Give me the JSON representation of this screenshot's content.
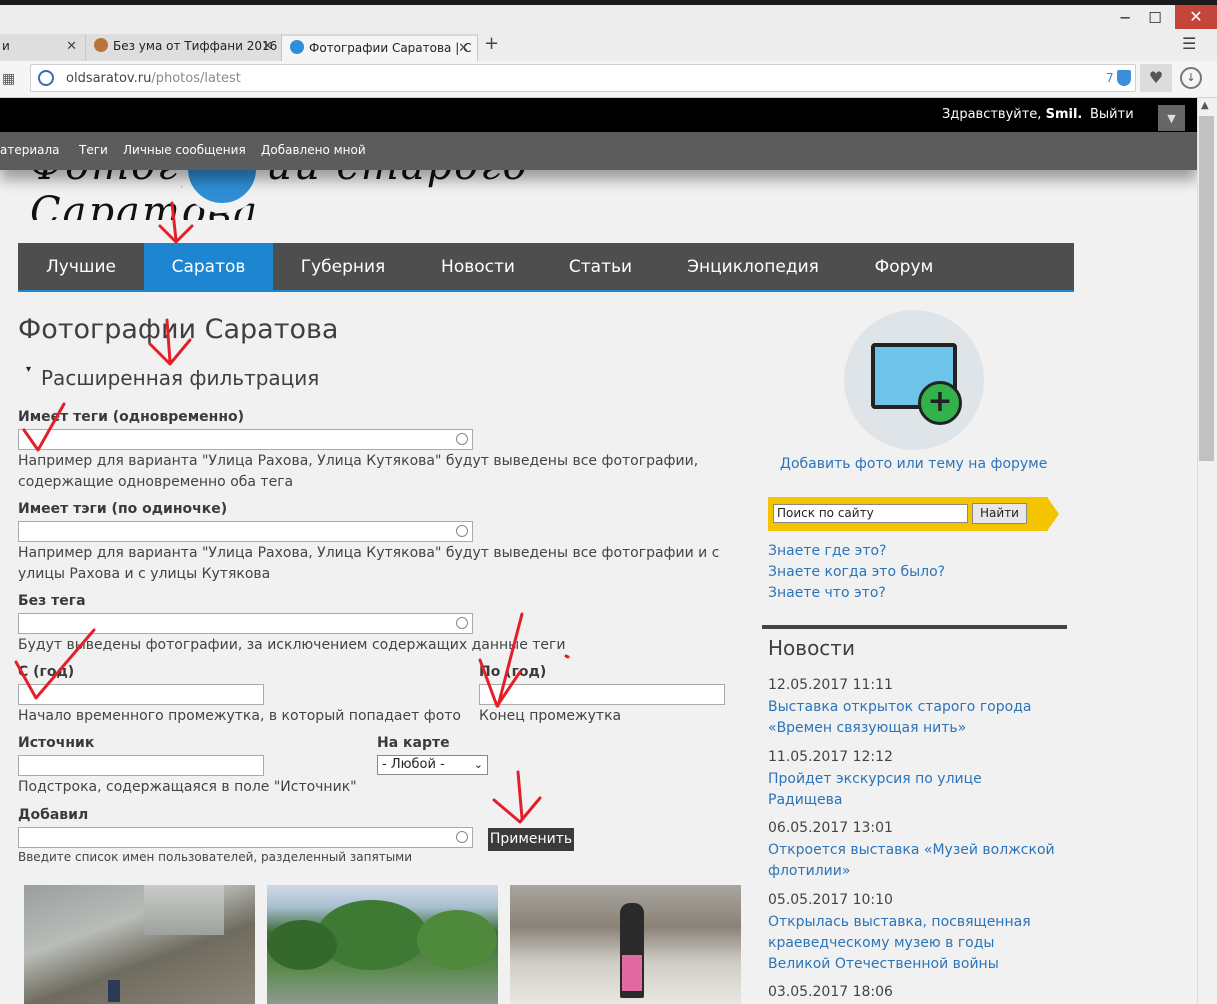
{
  "browser": {
    "tabs": [
      {
        "label": "и",
        "active": false
      },
      {
        "label": "Без ума от Тиффани 2016",
        "active": false
      },
      {
        "label": "Фотографии Саратова | С",
        "active": true
      }
    ],
    "new_tab_label": "+",
    "url_host": "oldsaratov.ru",
    "url_path": "/photos/latest",
    "extension_count": "7",
    "window_controls": {
      "minimize": "─",
      "maximize": "☐",
      "close": "✕"
    }
  },
  "site": {
    "greeting_prefix": "Здравствуйте,",
    "greeting_user": "Smil.",
    "logout_label": "Выйти",
    "user_menu_icon": "caret-down-icon",
    "top_nav": [
      "атериала",
      "Теги",
      "Личные сообщения",
      "Добавлено мной"
    ],
    "logo_text": "Фотографии старого Саратова",
    "main_nav": [
      {
        "label": "Лучшие",
        "active": false
      },
      {
        "label": "Саратов",
        "active": true
      },
      {
        "label": "Губерния",
        "active": false
      },
      {
        "label": "Новости",
        "active": false
      },
      {
        "label": "Статьи",
        "active": false
      },
      {
        "label": "Энциклопедия",
        "active": false
      },
      {
        "label": "Форум",
        "active": false
      }
    ],
    "accent_color": "#1e86d0"
  },
  "main": {
    "page_title": "Фотографии Саратова",
    "filter_title": "Расширенная фильтрация",
    "filter_toggle": "▾",
    "filters": {
      "tags_all": {
        "label": "Имеет теги (одновременно)",
        "value": "",
        "hint": "Например для варианта \"Улица Рахова, Улица Кутякова\" будут выведены все фотографии, содержащие одновременно оба тега"
      },
      "tags_any": {
        "label": "Имеет тэги (по одиночке)",
        "value": "",
        "hint": "Например для варианта \"Улица Рахова, Улица Кутякова\" будут выведены все фотографии и с улицы Рахова и с улицы Кутякова"
      },
      "tags_without": {
        "label": "Без тега",
        "value": "",
        "hint": "Будут выведены фотографии, за исключением содержащих данные теги"
      },
      "year_from": {
        "label": "С (год)",
        "value": "",
        "hint": "Начало временного промежутка, в который попадает фото"
      },
      "year_to": {
        "label": "По (год)",
        "value": "",
        "hint": "Конец промежутка"
      },
      "source": {
        "label": "Источник",
        "value": "",
        "hint": "Подстрока, содержащаяся в поле \"Источник\""
      },
      "on_map": {
        "label": "На карте",
        "selected": "- Любой -"
      },
      "added_by": {
        "label": "Добавил",
        "value": "",
        "hint": "Введите список имен пользователей, разделенный запятыми"
      }
    },
    "apply_label": "Применить"
  },
  "sidebar": {
    "add_photo_label": "Добавить фото или тему на форуме",
    "search_placeholder": "Поиск по сайту",
    "search_button": "Найти",
    "quiz_links": [
      "Знаете где это?",
      "Знаете когда это было?",
      "Знаете что это?"
    ],
    "news_title": "Новости",
    "news": [
      {
        "date": "12.05.2017 11:11",
        "title": "Выставка открыток старого города «Времен связующая нить»"
      },
      {
        "date": "11.05.2017 12:12",
        "title": "Пройдет экскурсия по улице Радищева"
      },
      {
        "date": "06.05.2017 13:01",
        "title": "Откроется выставка «Музей волжской флотилии»"
      },
      {
        "date": "05.05.2017 10:10",
        "title": "Открылась выставка, посвященная краеведческому музею в годы Великой Отечественной войны"
      },
      {
        "date": "03.05.2017 18:06",
        "title": ""
      }
    ]
  },
  "annotations": {
    "color": "#e3202a"
  }
}
